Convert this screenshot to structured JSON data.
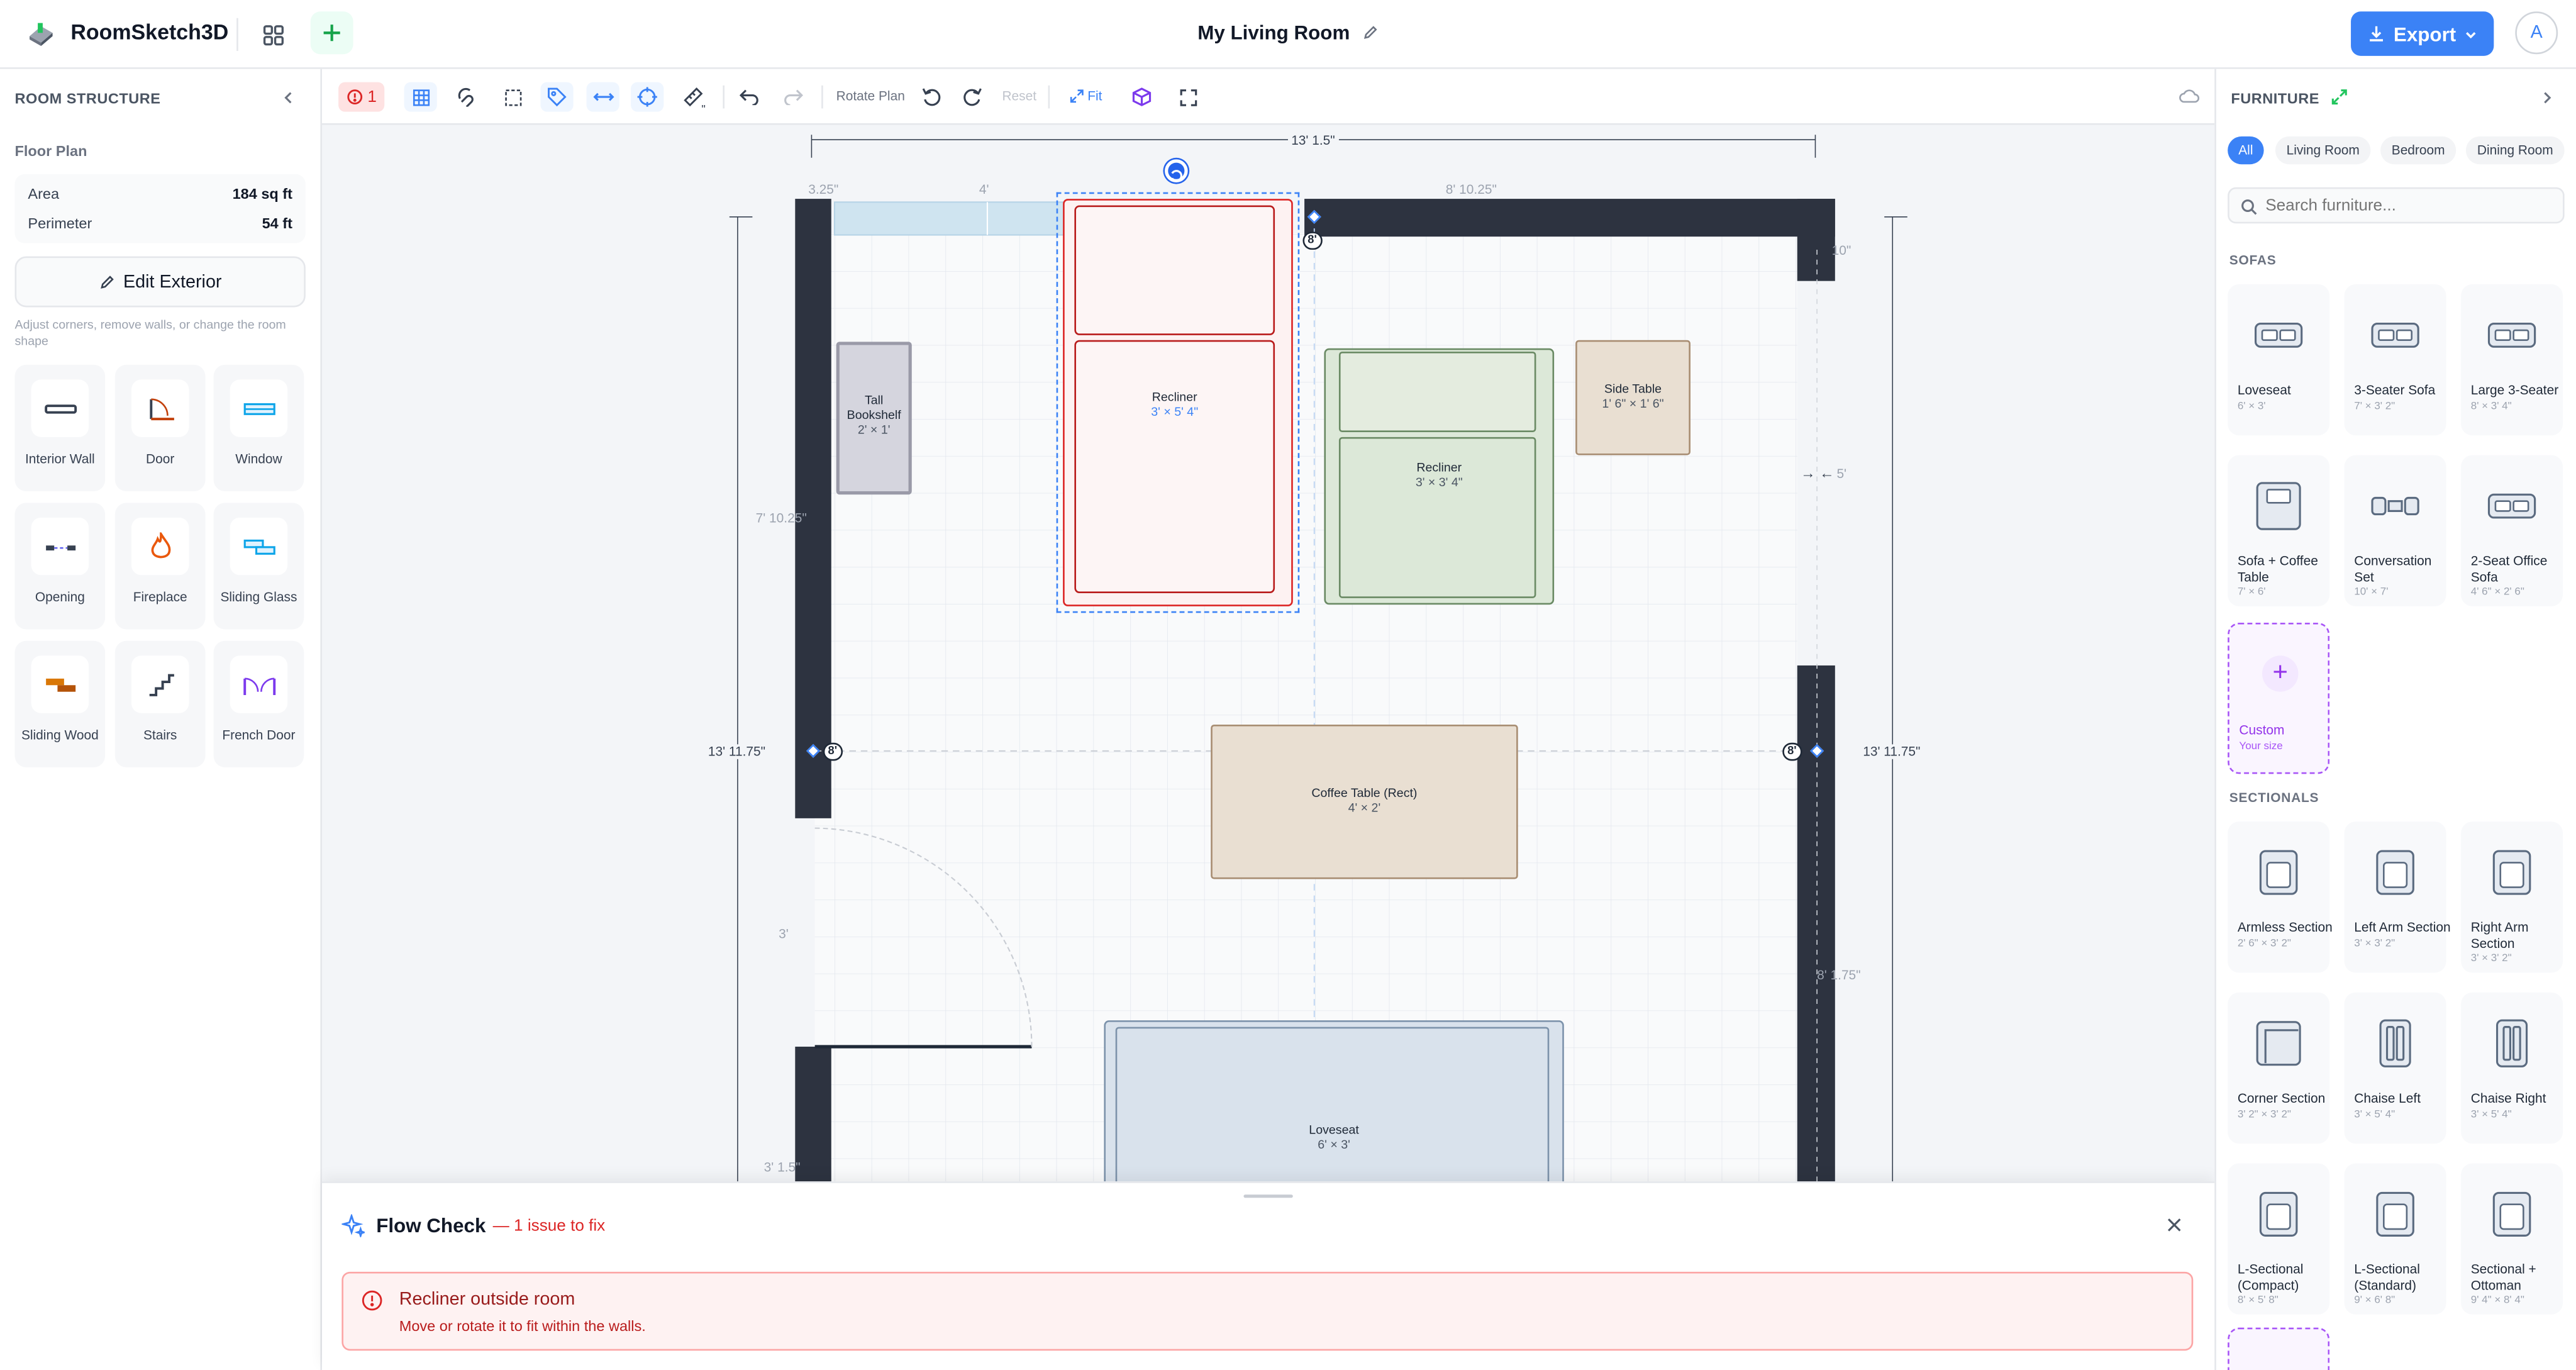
{
  "header": {
    "app_name": "RoomSketch3D",
    "title": "My Living Room",
    "export_label": "Export",
    "avatar_initial": "A"
  },
  "left_panel": {
    "heading": "ROOM STRUCTURE",
    "floor_plan_label": "Floor Plan",
    "area_label": "Area",
    "area_value": "184 sq ft",
    "perimeter_label": "Perimeter",
    "perimeter_value": "54 ft",
    "edit_exterior_label": "Edit Exterior",
    "hint": "Adjust corners, remove walls, or change the room shape",
    "tools": [
      {
        "label": "Interior Wall",
        "icon": "interior-wall-icon"
      },
      {
        "label": "Door",
        "icon": "door-icon"
      },
      {
        "label": "Window",
        "icon": "window-icon"
      },
      {
        "label": "Opening",
        "icon": "opening-icon"
      },
      {
        "label": "Fireplace",
        "icon": "fireplace-icon"
      },
      {
        "label": "Sliding Glass",
        "icon": "sliding-glass-icon"
      },
      {
        "label": "Sliding Wood",
        "icon": "sliding-wood-icon"
      },
      {
        "label": "Stairs",
        "icon": "stairs-icon"
      },
      {
        "label": "French Door",
        "icon": "french-door-icon"
      }
    ]
  },
  "toolbar": {
    "issue_count": "1",
    "rotate_plan_label": "Rotate Plan",
    "reset_label": "Reset",
    "fit_label": "Fit",
    "ruler_units": "\""
  },
  "canvas": {
    "dimensions": {
      "top_total": "13' 1.5\"",
      "top_a": "3.25\"",
      "top_b": "4'",
      "top_c": "8' 10.25\"",
      "right_top": "10\"",
      "right_mid": "5'",
      "right_lower": "8' 1.75\"",
      "left_upper": "7' 10.25\"",
      "left_mid": "3'",
      "left_lower": "3' 1.5\"",
      "height_left": "13' 11.75\"",
      "height_right": "13' 11.75\"",
      "wall_h_a": "8'",
      "wall_h_b": "8'",
      "wall_h_c": "8'"
    },
    "furniture": [
      {
        "name": "Tall Bookshelf",
        "size": "2' × 1'"
      },
      {
        "name": "Recliner",
        "size": "3' × 5' 4\""
      },
      {
        "name": "Recliner",
        "size": "3' × 3' 4\""
      },
      {
        "name": "Side Table",
        "size": "1' 6\" × 1' 6\""
      },
      {
        "name": "Coffee Table (Rect)",
        "size": "4' × 2'"
      },
      {
        "name": "Loveseat",
        "size": "6' × 3'"
      }
    ]
  },
  "flow_check": {
    "title": "Flow Check",
    "summary": "— 1 issue to fix",
    "issue_title": "Recliner outside room",
    "issue_detail": "Move or rotate it to fit within the walls."
  },
  "right_panel": {
    "heading": "FURNITURE",
    "filters": [
      "All",
      "Living Room",
      "Bedroom",
      "Dining Room"
    ],
    "search_placeholder": "Search furniture...",
    "sofas_heading": "SOFAS",
    "sofas": [
      {
        "name": "Loveseat",
        "size": "6' × 3'"
      },
      {
        "name": "3-Seater Sofa",
        "size": "7' × 3' 2\""
      },
      {
        "name": "Large 3-Seater",
        "size": "8' × 3' 4\""
      },
      {
        "name": "Sofa + Coffee Table",
        "size": "7' × 6'"
      },
      {
        "name": "Conversation Set",
        "size": "10' × 7'"
      },
      {
        "name": "2-Seat Office Sofa",
        "size": "4' 6\" × 2' 6\""
      }
    ],
    "custom_label": "Custom",
    "custom_sub": "Your size",
    "sectionals_heading": "SECTIONALS",
    "sectionals": [
      {
        "name": "Armless Section",
        "size": "2' 6\" × 3' 2\""
      },
      {
        "name": "Left Arm Section",
        "size": "3' × 3' 2\""
      },
      {
        "name": "Right Arm Section",
        "size": "3' × 3' 2\""
      },
      {
        "name": "Corner Section",
        "size": "3' 2\" × 3' 2\""
      },
      {
        "name": "Chaise Left",
        "size": "3' × 5' 4\""
      },
      {
        "name": "Chaise Right",
        "size": "3' × 5' 4\""
      },
      {
        "name": "L-Sectional (Compact)",
        "size": "8' × 5' 8\""
      },
      {
        "name": "L-Sectional (Standard)",
        "size": "9' × 6' 8\""
      },
      {
        "name": "Sectional + Ottoman",
        "size": "9' 4\" × 8' 4\""
      }
    ]
  },
  "colors": {
    "accent": "#3b82f6",
    "wall": "#2d3340",
    "error": "#dc2626",
    "custom": "#9333ea"
  }
}
